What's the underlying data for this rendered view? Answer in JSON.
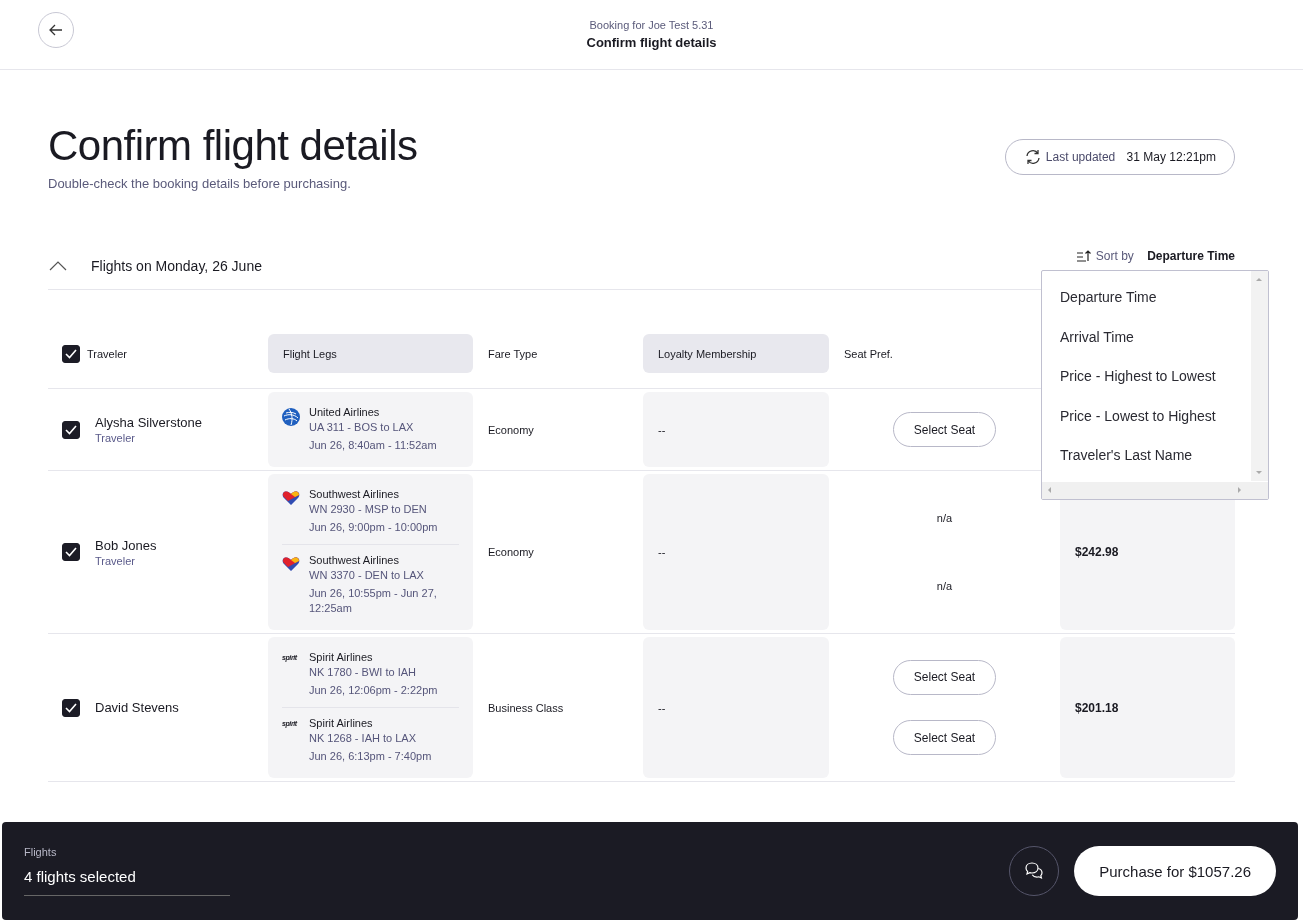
{
  "header": {
    "subtitle": "Booking for Joe Test 5.31",
    "title": "Confirm flight details"
  },
  "page": {
    "title": "Confirm flight details",
    "subtitle": "Double-check the booking details before purchasing.",
    "last_updated_label": "Last updated",
    "last_updated_value": "31 May 12:21pm"
  },
  "section": {
    "title": "Flights on Monday, 26 June",
    "expanded": true,
    "sort_label": "Sort by",
    "sort_value": "Departure Time"
  },
  "sort_menu": {
    "options": [
      "Departure Time",
      "Arrival Time",
      "Price - Highest to Lowest",
      "Price - Lowest to Highest",
      "Traveler's Last Name"
    ]
  },
  "table": {
    "select_all": {
      "label": "Traveler",
      "checked": true
    },
    "columns": [
      {
        "label": "Flight Legs",
        "shaded": true
      },
      {
        "label": "Fare Type",
        "shaded": false
      },
      {
        "label": "Loyalty Membership",
        "shaded": true
      },
      {
        "label": "Seat Pref.",
        "shaded": false
      }
    ],
    "rows": [
      {
        "name": "Alysha Silverstone",
        "role": "Traveler",
        "checked": true,
        "fare": "Economy",
        "loyalty": "--",
        "legs": [
          {
            "kind": "globe",
            "airline": "United Airlines",
            "flight": "UA 311 - BOS to LAX",
            "time": "Jun 26, 8:40am - 11:52am",
            "seat": {
              "kind": "button",
              "text": "Select Seat"
            }
          }
        ]
      },
      {
        "name": "Bob Jones",
        "role": "Traveler",
        "checked": true,
        "fare": "Economy",
        "loyalty": "--",
        "price": "$242.98",
        "legs": [
          {
            "kind": "heart",
            "airline": "Southwest Airlines",
            "flight": "WN 2930 - MSP to DEN",
            "time": "Jun 26, 9:00pm - 10:00pm",
            "seat": {
              "kind": "text",
              "text": "n/a"
            }
          },
          {
            "kind": "heart",
            "airline": "Southwest Airlines",
            "flight": "WN 3370 - DEN to LAX",
            "time": "Jun 26, 10:55pm - Jun 27, 12:25am",
            "seat": {
              "kind": "text",
              "text": "n/a"
            }
          }
        ]
      },
      {
        "name": "David Stevens",
        "checked": true,
        "fare": "Business Class",
        "loyalty": "--",
        "price": "$201.18",
        "legs": [
          {
            "kind": "wordmark",
            "logo_text": "spirit",
            "airline": "Spirit Airlines",
            "flight": "NK 1780 - BWI to IAH",
            "time": "Jun 26, 12:06pm - 2:22pm",
            "seat": {
              "kind": "button",
              "text": "Select Seat"
            }
          },
          {
            "kind": "wordmark",
            "logo_text": "spirit",
            "airline": "Spirit Airlines",
            "flight": "NK 1268 - IAH to LAX",
            "time": "Jun 26, 6:13pm - 7:40pm",
            "seat": {
              "kind": "button",
              "text": "Select Seat"
            }
          }
        ]
      }
    ]
  },
  "footer": {
    "label": "Flights",
    "value": "4 flights selected",
    "purchase": "Purchase for $1057.26"
  }
}
